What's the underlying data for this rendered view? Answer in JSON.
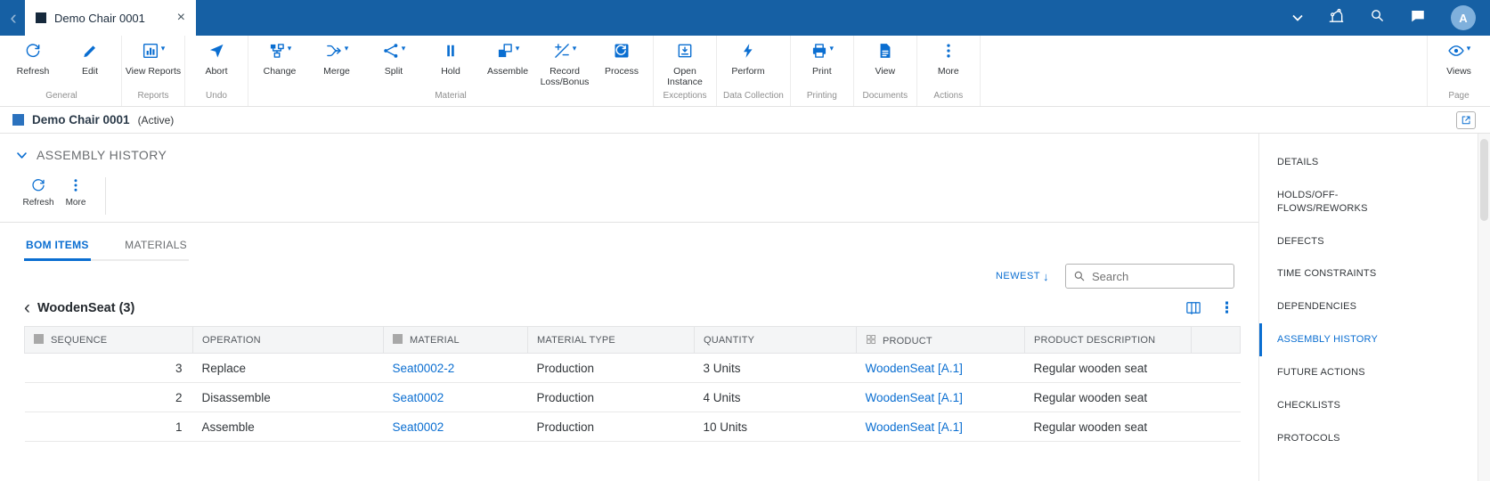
{
  "colors": {
    "shell_blue": "#1660a4",
    "accent_blue": "#0a6ed1",
    "link_blue": "#0a6ed1"
  },
  "icons": {
    "close": "×",
    "back": "‹",
    "caret_down": "▾",
    "vertical_dots": "⋮",
    "sort_descending_arrow": "↓"
  },
  "shell": {
    "tab_title": "Demo Chair 0001",
    "avatar_initial": "A"
  },
  "ribbon": {
    "groups": [
      {
        "label": "General",
        "buttons": [
          {
            "label": "Refresh"
          },
          {
            "label": "Edit"
          }
        ]
      },
      {
        "label": "Reports",
        "buttons": [
          {
            "label": "View Reports"
          }
        ]
      },
      {
        "label": "Undo",
        "buttons": [
          {
            "label": "Abort"
          }
        ]
      },
      {
        "label": "Material",
        "buttons": [
          {
            "label": "Change"
          },
          {
            "label": "Merge"
          },
          {
            "label": "Split"
          },
          {
            "label": "Hold"
          },
          {
            "label": "Assemble"
          },
          {
            "label": "Record Loss/Bonus"
          },
          {
            "label": "Process"
          }
        ]
      },
      {
        "label": "Exceptions",
        "buttons": [
          {
            "label": "Open Instance"
          }
        ]
      },
      {
        "label": "Data Collection",
        "buttons": [
          {
            "label": "Perform"
          }
        ]
      },
      {
        "label": "Printing",
        "buttons": [
          {
            "label": "Print"
          }
        ]
      },
      {
        "label": "Documents",
        "buttons": [
          {
            "label": "View"
          }
        ]
      },
      {
        "label": "Actions",
        "buttons": [
          {
            "label": "More"
          }
        ]
      }
    ],
    "page_group": {
      "label": "Page",
      "buttons": [
        {
          "label": "Views"
        }
      ]
    }
  },
  "object_header": {
    "title": "Demo Chair 0001",
    "status": "(Active)"
  },
  "assembly_section": {
    "title": "ASSEMBLY HISTORY",
    "toolbar": {
      "refresh": "Refresh",
      "more": "More"
    },
    "tabs": [
      {
        "label": "BOM ITEMS"
      },
      {
        "label": "MATERIALS"
      }
    ],
    "sort_label": "NEWEST",
    "search_placeholder": "Search",
    "group_title": "WoodenSeat (3)"
  },
  "table": {
    "columns": [
      "SEQUENCE",
      "OPERATION",
      "MATERIAL",
      "MATERIAL TYPE",
      "QUANTITY",
      "PRODUCT",
      "PRODUCT DESCRIPTION"
    ],
    "rows": [
      {
        "sequence": "3",
        "operation": "Replace",
        "material": "Seat0002-2",
        "material_type": "Production",
        "quantity": "3 Units",
        "product": "WoodenSeat [A.1]",
        "product_description": "Regular wooden seat"
      },
      {
        "sequence": "2",
        "operation": "Disassemble",
        "material": "Seat0002",
        "material_type": "Production",
        "quantity": "4 Units",
        "product": "WoodenSeat [A.1]",
        "product_description": "Regular wooden seat"
      },
      {
        "sequence": "1",
        "operation": "Assemble",
        "material": "Seat0002",
        "material_type": "Production",
        "quantity": "10 Units",
        "product": "WoodenSeat [A.1]",
        "product_description": "Regular wooden seat"
      }
    ]
  },
  "sidebar": {
    "items": [
      {
        "label": "DETAILS"
      },
      {
        "label": "HOLDS/OFF-\nFLOWS/REWORKS"
      },
      {
        "label": "DEFECTS"
      },
      {
        "label": "TIME CONSTRAINTS"
      },
      {
        "label": "DEPENDENCIES"
      },
      {
        "label": "ASSEMBLY HISTORY",
        "active": true
      },
      {
        "label": "FUTURE ACTIONS"
      },
      {
        "label": "CHECKLISTS"
      },
      {
        "label": "PROTOCOLS"
      }
    ]
  }
}
